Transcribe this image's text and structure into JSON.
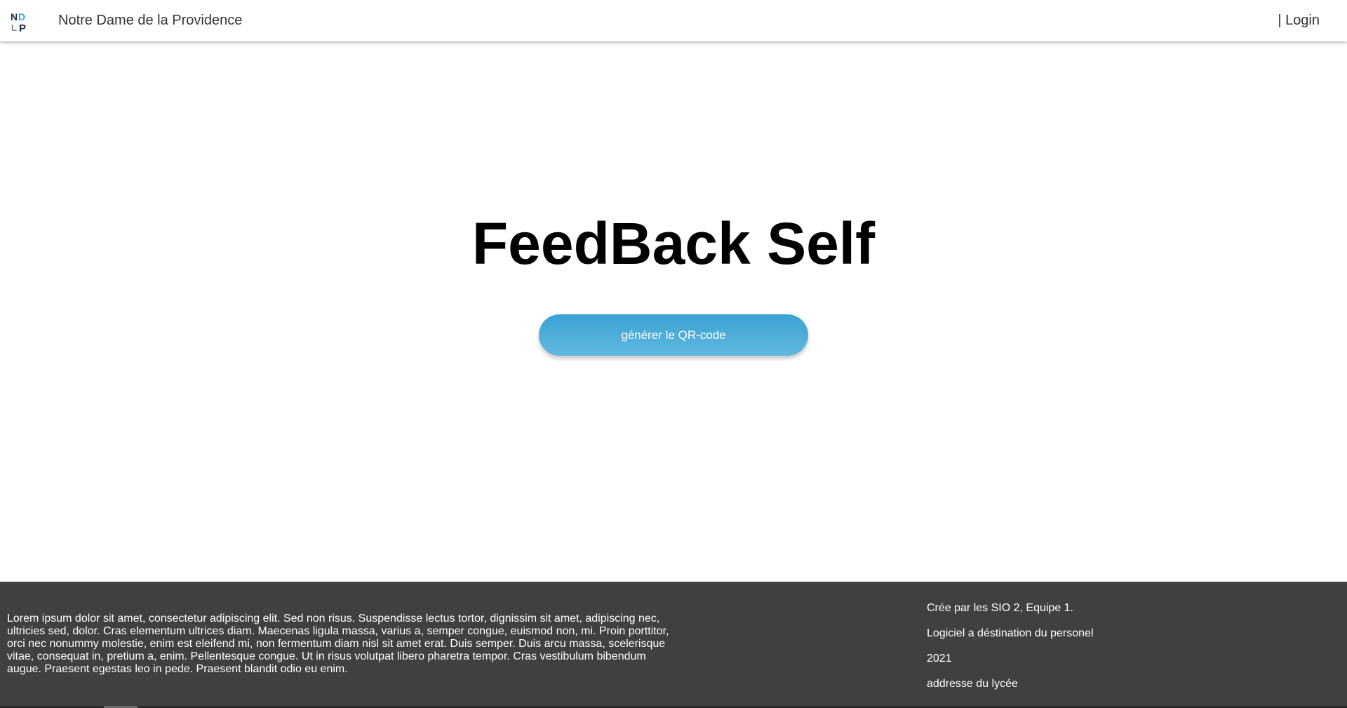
{
  "navbar": {
    "brand": "Notre Dame de la Providence",
    "login": "| Login",
    "logo_letters": [
      "N",
      "D",
      "L",
      "P"
    ],
    "colors": {
      "logo_dark": "#1f2a44",
      "logo_blue": "#2aa6dc",
      "logo_gray": "#8a8a8a"
    }
  },
  "main": {
    "title": "FeedBack Self",
    "button_label": "générer le QR-code",
    "button_color": "#3aa2d4"
  },
  "footer": {
    "lorem": "Lorem ipsum dolor sit amet, consectetur adipiscing elit. Sed non risus. Suspendisse lectus tortor, dignissim sit amet, adipiscing nec, ultricies sed, dolor. Cras elementum ultrices diam. Maecenas ligula massa, varius a, semper congue, euismod non, mi. Proin porttitor, orci nec nonummy molestie, enim est eleifend mi, non fermentum diam nisl sit amet erat. Duis semper. Duis arcu massa, scelerisque vitae, consequat in, pretium a, enim. Pellentesque congue. Ut in risus volutpat libero pharetra tempor. Cras vestibulum bibendum augue. Praesent egestas leo in pede. Praesent blandit odio eu enim.",
    "info": [
      "Crée par les SIO 2, Equipe 1.",
      "Logiciel a déstination du personel",
      "2021",
      "addresse du lycée"
    ],
    "background": "#404040"
  }
}
